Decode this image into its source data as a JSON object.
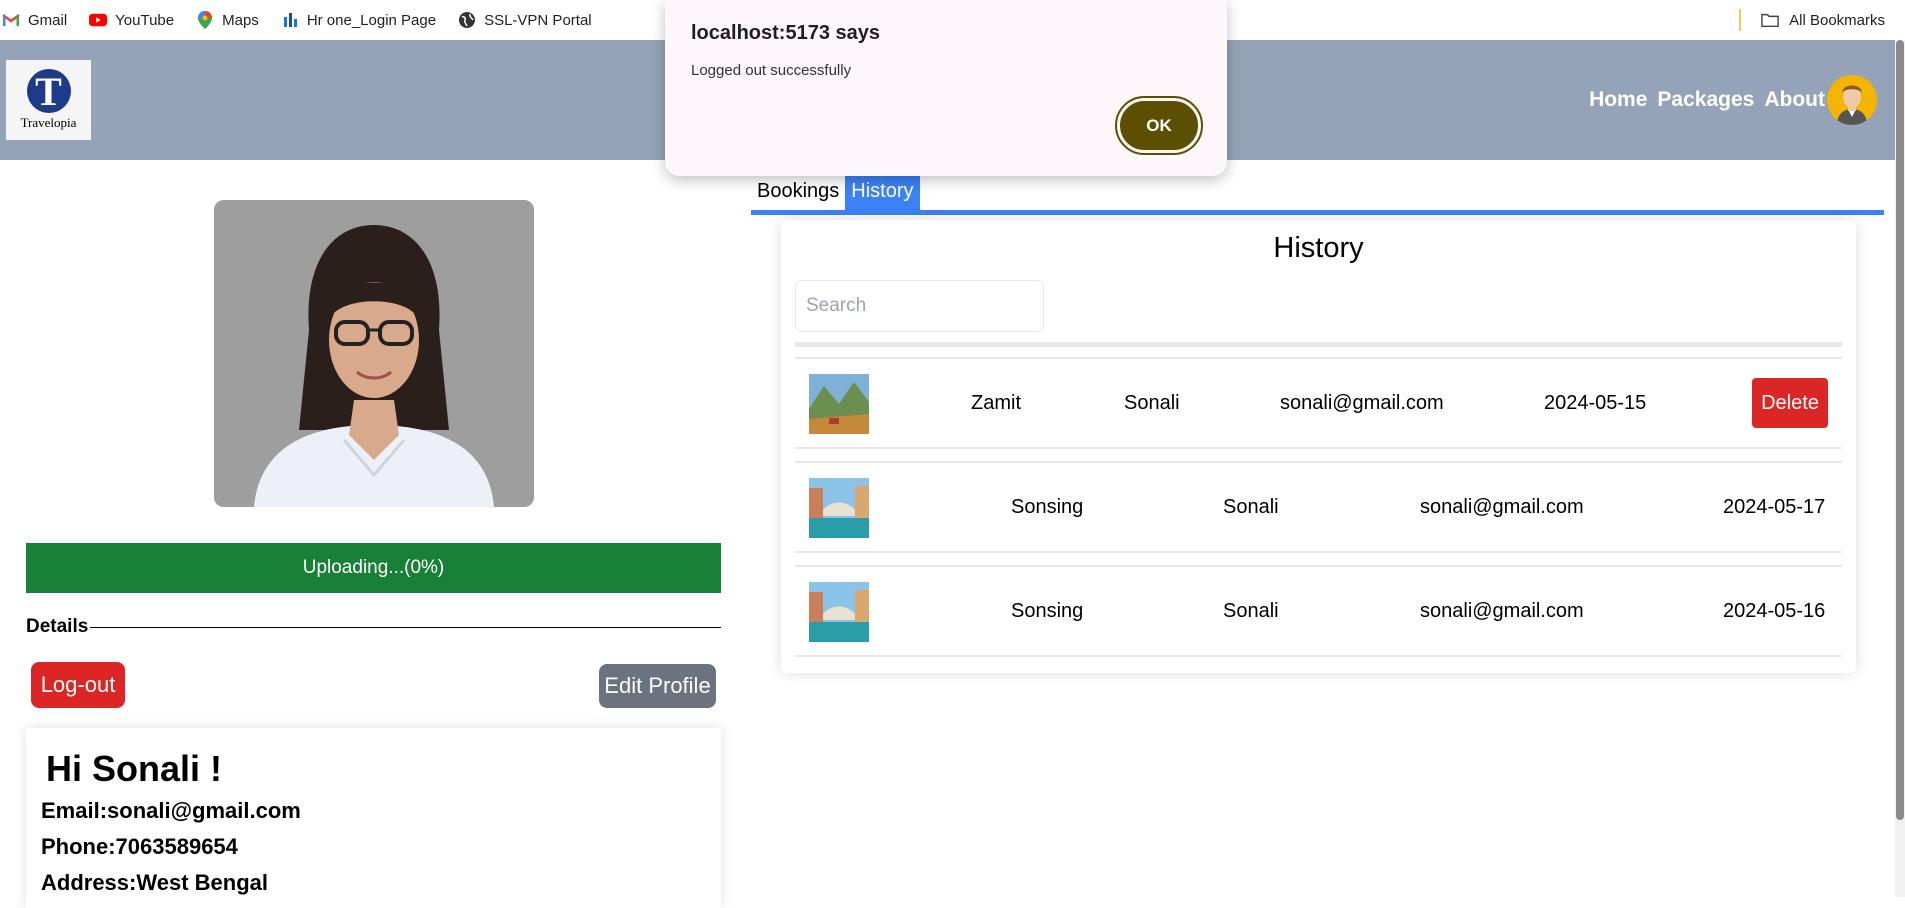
{
  "bookmarks": {
    "items": [
      {
        "label": "Gmail",
        "icon": "gmail-icon"
      },
      {
        "label": "YouTube",
        "icon": "youtube-icon"
      },
      {
        "label": "Maps",
        "icon": "maps-icon"
      },
      {
        "label": "Hr one_Login Page",
        "icon": "hrone-icon"
      },
      {
        "label": "SSL-VPN Portal",
        "icon": "globe-icon"
      }
    ],
    "all_bookmarks": "All Bookmarks"
  },
  "navbar": {
    "logo_letter": "T",
    "logo_text": "Travelopia",
    "links": [
      "Home",
      "Packages",
      "About"
    ]
  },
  "profile": {
    "upload_status": "Uploading...(0%)",
    "details_label": "Details",
    "logout_label": "Log-out",
    "edit_label": "Edit Profile",
    "greeting": "Hi Sonali !",
    "email": "Email:sonali@gmail.com",
    "phone": "Phone:7063589654",
    "address": "Address:West Bengal"
  },
  "tabs": [
    "Bookings",
    "History"
  ],
  "history": {
    "title": "History",
    "search_placeholder": "Search",
    "delete_label": "Delete",
    "rows": [
      {
        "place": "Zamit",
        "name": "Sonali",
        "email": "sonali@gmail.com",
        "date": "2024-05-15"
      },
      {
        "place": "Sonsing",
        "name": "Sonali",
        "email": "sonali@gmail.com",
        "date": "2024-05-17"
      },
      {
        "place": "Sonsing",
        "name": "Sonali",
        "email": "sonali@gmail.com",
        "date": "2024-05-16"
      }
    ]
  },
  "dialog": {
    "title": "localhost:5173 says",
    "message": "Logged out successfully",
    "ok_label": "OK"
  },
  "colors": {
    "navbar": "#94a3b8",
    "upload_bar": "#198038",
    "danger": "#dc2626",
    "tab_accent": "#3b82f6",
    "dialog_ok": "#5c4f00"
  }
}
